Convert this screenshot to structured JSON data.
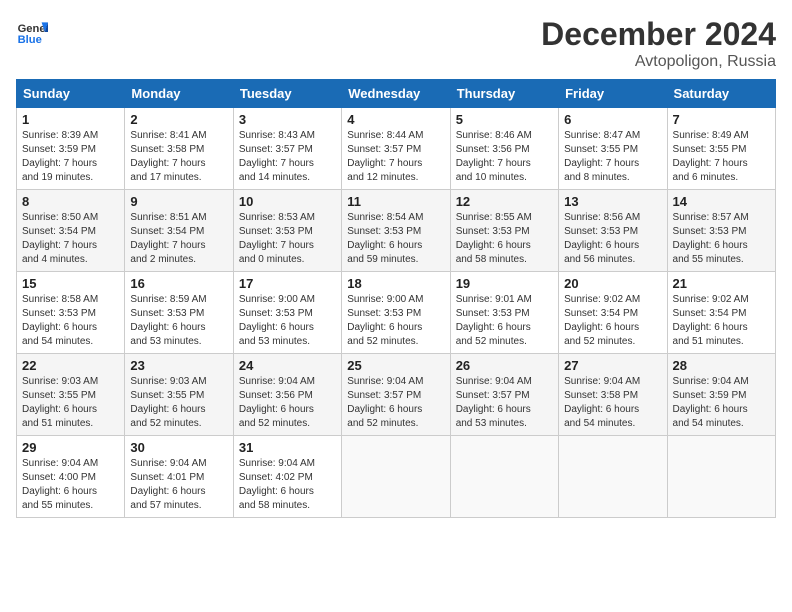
{
  "header": {
    "logo_line1": "General",
    "logo_line2": "Blue",
    "month_title": "December 2024",
    "subtitle": "Avtopoligon, Russia"
  },
  "days_of_week": [
    "Sunday",
    "Monday",
    "Tuesday",
    "Wednesday",
    "Thursday",
    "Friday",
    "Saturday"
  ],
  "weeks": [
    [
      {
        "day": "1",
        "info": "Sunrise: 8:39 AM\nSunset: 3:59 PM\nDaylight: 7 hours\nand 19 minutes."
      },
      {
        "day": "2",
        "info": "Sunrise: 8:41 AM\nSunset: 3:58 PM\nDaylight: 7 hours\nand 17 minutes."
      },
      {
        "day": "3",
        "info": "Sunrise: 8:43 AM\nSunset: 3:57 PM\nDaylight: 7 hours\nand 14 minutes."
      },
      {
        "day": "4",
        "info": "Sunrise: 8:44 AM\nSunset: 3:57 PM\nDaylight: 7 hours\nand 12 minutes."
      },
      {
        "day": "5",
        "info": "Sunrise: 8:46 AM\nSunset: 3:56 PM\nDaylight: 7 hours\nand 10 minutes."
      },
      {
        "day": "6",
        "info": "Sunrise: 8:47 AM\nSunset: 3:55 PM\nDaylight: 7 hours\nand 8 minutes."
      },
      {
        "day": "7",
        "info": "Sunrise: 8:49 AM\nSunset: 3:55 PM\nDaylight: 7 hours\nand 6 minutes."
      }
    ],
    [
      {
        "day": "8",
        "info": "Sunrise: 8:50 AM\nSunset: 3:54 PM\nDaylight: 7 hours\nand 4 minutes."
      },
      {
        "day": "9",
        "info": "Sunrise: 8:51 AM\nSunset: 3:54 PM\nDaylight: 7 hours\nand 2 minutes."
      },
      {
        "day": "10",
        "info": "Sunrise: 8:53 AM\nSunset: 3:53 PM\nDaylight: 7 hours\nand 0 minutes."
      },
      {
        "day": "11",
        "info": "Sunrise: 8:54 AM\nSunset: 3:53 PM\nDaylight: 6 hours\nand 59 minutes."
      },
      {
        "day": "12",
        "info": "Sunrise: 8:55 AM\nSunset: 3:53 PM\nDaylight: 6 hours\nand 58 minutes."
      },
      {
        "day": "13",
        "info": "Sunrise: 8:56 AM\nSunset: 3:53 PM\nDaylight: 6 hours\nand 56 minutes."
      },
      {
        "day": "14",
        "info": "Sunrise: 8:57 AM\nSunset: 3:53 PM\nDaylight: 6 hours\nand 55 minutes."
      }
    ],
    [
      {
        "day": "15",
        "info": "Sunrise: 8:58 AM\nSunset: 3:53 PM\nDaylight: 6 hours\nand 54 minutes."
      },
      {
        "day": "16",
        "info": "Sunrise: 8:59 AM\nSunset: 3:53 PM\nDaylight: 6 hours\nand 53 minutes."
      },
      {
        "day": "17",
        "info": "Sunrise: 9:00 AM\nSunset: 3:53 PM\nDaylight: 6 hours\nand 53 minutes."
      },
      {
        "day": "18",
        "info": "Sunrise: 9:00 AM\nSunset: 3:53 PM\nDaylight: 6 hours\nand 52 minutes."
      },
      {
        "day": "19",
        "info": "Sunrise: 9:01 AM\nSunset: 3:53 PM\nDaylight: 6 hours\nand 52 minutes."
      },
      {
        "day": "20",
        "info": "Sunrise: 9:02 AM\nSunset: 3:54 PM\nDaylight: 6 hours\nand 52 minutes."
      },
      {
        "day": "21",
        "info": "Sunrise: 9:02 AM\nSunset: 3:54 PM\nDaylight: 6 hours\nand 51 minutes."
      }
    ],
    [
      {
        "day": "22",
        "info": "Sunrise: 9:03 AM\nSunset: 3:55 PM\nDaylight: 6 hours\nand 51 minutes."
      },
      {
        "day": "23",
        "info": "Sunrise: 9:03 AM\nSunset: 3:55 PM\nDaylight: 6 hours\nand 52 minutes."
      },
      {
        "day": "24",
        "info": "Sunrise: 9:04 AM\nSunset: 3:56 PM\nDaylight: 6 hours\nand 52 minutes."
      },
      {
        "day": "25",
        "info": "Sunrise: 9:04 AM\nSunset: 3:57 PM\nDaylight: 6 hours\nand 52 minutes."
      },
      {
        "day": "26",
        "info": "Sunrise: 9:04 AM\nSunset: 3:57 PM\nDaylight: 6 hours\nand 53 minutes."
      },
      {
        "day": "27",
        "info": "Sunrise: 9:04 AM\nSunset: 3:58 PM\nDaylight: 6 hours\nand 54 minutes."
      },
      {
        "day": "28",
        "info": "Sunrise: 9:04 AM\nSunset: 3:59 PM\nDaylight: 6 hours\nand 54 minutes."
      }
    ],
    [
      {
        "day": "29",
        "info": "Sunrise: 9:04 AM\nSunset: 4:00 PM\nDaylight: 6 hours\nand 55 minutes."
      },
      {
        "day": "30",
        "info": "Sunrise: 9:04 AM\nSunset: 4:01 PM\nDaylight: 6 hours\nand 57 minutes."
      },
      {
        "day": "31",
        "info": "Sunrise: 9:04 AM\nSunset: 4:02 PM\nDaylight: 6 hours\nand 58 minutes."
      },
      {
        "day": "",
        "info": ""
      },
      {
        "day": "",
        "info": ""
      },
      {
        "day": "",
        "info": ""
      },
      {
        "day": "",
        "info": ""
      }
    ]
  ]
}
